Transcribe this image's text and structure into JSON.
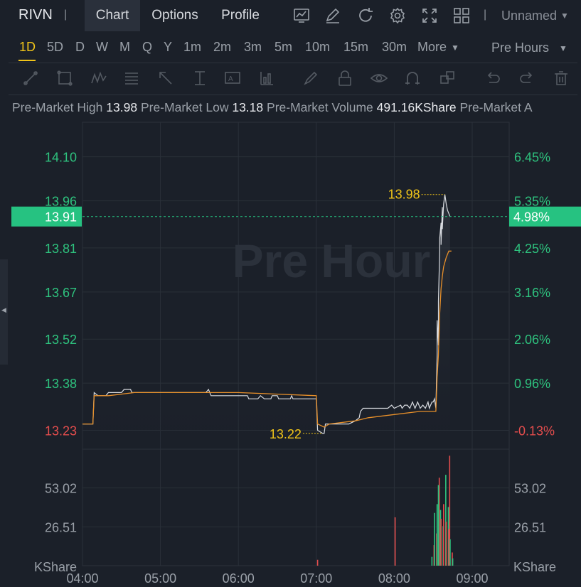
{
  "header": {
    "ticker": "RIVN",
    "separator": "|",
    "tabs": [
      {
        "label": "Chart",
        "active": true
      },
      {
        "label": "Options",
        "active": false
      },
      {
        "label": "Profile",
        "active": false
      }
    ],
    "icons": [
      "indicator-chart-icon",
      "draw-pen-icon",
      "refresh-icon",
      "settings-gear-icon",
      "fullscreen-icon",
      "layout-grid-icon"
    ],
    "layout_name": "Unnamed"
  },
  "timeframes": {
    "items": [
      "1D",
      "5D",
      "D",
      "W",
      "M",
      "Q",
      "Y",
      "1m",
      "2m",
      "3m",
      "5m",
      "10m",
      "15m",
      "30m",
      "More"
    ],
    "active": "1D",
    "session": "Pre Hours"
  },
  "drawing_tools": [
    "trend-line-icon",
    "rectangle-icon",
    "pattern-icon",
    "fib-lines-icon",
    "arrow-icon",
    "measure-icon",
    "text-icon",
    "bar-pattern-icon",
    "brush-icon",
    "lock-icon",
    "eye-icon",
    "magnet-icon",
    "layers-icon",
    "undo-icon",
    "redo-icon",
    "trash-icon"
  ],
  "stats": {
    "high_label": "Pre-Market High",
    "high_value": "13.98",
    "low_label": "Pre-Market Low",
    "low_value": "13.18",
    "volume_label": "Pre-Market Volume",
    "volume_value": "491.16KShare",
    "trailing_label": "Pre-Market A"
  },
  "chart_data": {
    "type": "line",
    "watermark": "Pre Hour",
    "x_ticks": [
      "04:00",
      "05:00",
      "06:00",
      "07:00",
      "08:00",
      "09:00"
    ],
    "price_ticks_left": [
      "14.10",
      "13.96",
      "13.81",
      "13.67",
      "13.52",
      "13.38",
      "13.23"
    ],
    "percent_ticks_right": [
      "6.45%",
      "5.35%",
      "4.25%",
      "3.16%",
      "2.06%",
      "0.96%",
      "-0.13%"
    ],
    "ylim": [
      13.17,
      14.21
    ],
    "prev_close": 13.25,
    "last_price": "13.91",
    "last_percent": "4.98%",
    "high_marker": {
      "label": "13.98",
      "time": "08:39",
      "value": 13.98
    },
    "low_marker": {
      "label": "13.22",
      "time": "07:05",
      "value": 13.22
    },
    "series": [
      {
        "name": "Price",
        "color": "#d8dbe0",
        "points": [
          [
            "04:00",
            13.25
          ],
          [
            "04:08",
            13.25
          ],
          [
            "04:09",
            13.35
          ],
          [
            "04:12",
            13.34
          ],
          [
            "04:18",
            13.34
          ],
          [
            "04:20",
            13.35
          ],
          [
            "04:30",
            13.35
          ],
          [
            "04:32",
            13.36
          ],
          [
            "04:37",
            13.36
          ],
          [
            "04:38",
            13.35
          ],
          [
            "05:35",
            13.35
          ],
          [
            "05:37",
            13.36
          ],
          [
            "05:39",
            13.34
          ],
          [
            "05:55",
            13.34
          ],
          [
            "06:07",
            13.34
          ],
          [
            "06:08",
            13.33
          ],
          [
            "06:15",
            13.33
          ],
          [
            "06:17",
            13.34
          ],
          [
            "06:20",
            13.33
          ],
          [
            "06:25",
            13.33
          ],
          [
            "06:26",
            13.34
          ],
          [
            "06:30",
            13.34
          ],
          [
            "06:31",
            13.33
          ],
          [
            "06:40",
            13.33
          ],
          [
            "06:41",
            13.34
          ],
          [
            "06:42",
            13.33
          ],
          [
            "07:00",
            13.33
          ],
          [
            "07:01",
            13.23
          ],
          [
            "07:05",
            13.22
          ],
          [
            "07:06",
            13.22
          ],
          [
            "07:07",
            13.25
          ],
          [
            "07:15",
            13.25
          ],
          [
            "07:25",
            13.25
          ],
          [
            "07:30",
            13.26
          ],
          [
            "07:33",
            13.27
          ],
          [
            "07:34",
            13.29
          ],
          [
            "07:36",
            13.3
          ],
          [
            "07:40",
            13.3
          ],
          [
            "07:45",
            13.3
          ],
          [
            "07:50",
            13.3
          ],
          [
            "07:55",
            13.3
          ],
          [
            "07:58",
            13.31
          ],
          [
            "08:00",
            13.3
          ],
          [
            "08:05",
            13.31
          ],
          [
            "08:06",
            13.3
          ],
          [
            "08:08",
            13.31
          ],
          [
            "08:10",
            13.31
          ],
          [
            "08:12",
            13.3
          ],
          [
            "08:14",
            13.32
          ],
          [
            "08:16",
            13.3
          ],
          [
            "08:18",
            13.32
          ],
          [
            "08:20",
            13.3
          ],
          [
            "08:22",
            13.31
          ],
          [
            "08:24",
            13.3
          ],
          [
            "08:26",
            13.32
          ],
          [
            "08:27",
            13.3
          ],
          [
            "08:28",
            13.31
          ],
          [
            "08:29",
            13.32
          ],
          [
            "08:30",
            13.32
          ],
          [
            "08:31",
            13.33
          ],
          [
            "08:32",
            13.3
          ],
          [
            "08:33",
            13.47
          ],
          [
            "08:33",
            13.58
          ],
          [
            "08:34",
            13.5
          ],
          [
            "08:34",
            13.64
          ],
          [
            "08:35",
            13.8
          ],
          [
            "08:35",
            13.84
          ],
          [
            "08:36",
            13.89
          ],
          [
            "08:36",
            13.82
          ],
          [
            "08:37",
            13.94
          ],
          [
            "08:37",
            13.87
          ],
          [
            "08:38",
            13.95
          ],
          [
            "08:39",
            13.98
          ],
          [
            "08:40",
            13.95
          ],
          [
            "08:41",
            13.93
          ],
          [
            "08:42",
            13.92
          ],
          [
            "08:43",
            13.91
          ]
        ]
      },
      {
        "name": "Average",
        "color": "#e8902a",
        "points": [
          [
            "04:00",
            13.25
          ],
          [
            "04:08",
            13.25
          ],
          [
            "04:09",
            13.34
          ],
          [
            "04:20",
            13.34
          ],
          [
            "04:40",
            13.35
          ],
          [
            "06:00",
            13.35
          ],
          [
            "07:00",
            13.34
          ],
          [
            "07:01",
            13.25
          ],
          [
            "07:06",
            13.24
          ],
          [
            "07:10",
            13.25
          ],
          [
            "07:30",
            13.26
          ],
          [
            "07:40",
            13.27
          ],
          [
            "08:00",
            13.28
          ],
          [
            "08:20",
            13.29
          ],
          [
            "08:30",
            13.29
          ],
          [
            "08:32",
            13.29
          ],
          [
            "08:33",
            13.4
          ],
          [
            "08:34",
            13.47
          ],
          [
            "08:35",
            13.6
          ],
          [
            "08:36",
            13.68
          ],
          [
            "08:37",
            13.72
          ],
          [
            "08:38",
            13.75
          ],
          [
            "08:40",
            13.78
          ],
          [
            "08:42",
            13.8
          ],
          [
            "08:44",
            13.8
          ]
        ]
      }
    ],
    "volume": {
      "unit": "KShare",
      "ticks_left": [
        "53.02",
        "26.51"
      ],
      "ticks_right": [
        "53.02",
        "26.51"
      ],
      "ylim": [
        0,
        79.5
      ],
      "bars": [
        {
          "time": "07:01",
          "value": 4.0,
          "dir": "down"
        },
        {
          "time": "08:00",
          "value": 33.0,
          "dir": "down"
        },
        {
          "time": "08:29",
          "value": 6.0,
          "dir": "up"
        },
        {
          "time": "08:30",
          "value": 14.0,
          "dir": "down"
        },
        {
          "time": "08:31",
          "value": 36.0,
          "dir": "up"
        },
        {
          "time": "08:32",
          "value": 22.0,
          "dir": "down"
        },
        {
          "time": "08:33",
          "value": 42.0,
          "dir": "up"
        },
        {
          "time": "08:34",
          "value": 60.0,
          "dir": "down"
        },
        {
          "time": "08:34",
          "value": 55.0,
          "dir": "up"
        },
        {
          "time": "08:35",
          "value": 38.0,
          "dir": "up"
        },
        {
          "time": "08:36",
          "value": 32.0,
          "dir": "down"
        },
        {
          "time": "08:37",
          "value": 27.0,
          "dir": "up"
        },
        {
          "time": "08:38",
          "value": 42.0,
          "dir": "down"
        },
        {
          "time": "08:39",
          "value": 62.0,
          "dir": "up"
        },
        {
          "time": "08:40",
          "value": 30.0,
          "dir": "down"
        },
        {
          "time": "08:41",
          "value": 40.0,
          "dir": "up"
        },
        {
          "time": "08:42",
          "value": 25.0,
          "dir": "down"
        },
        {
          "time": "08:42",
          "value": 75.0,
          "dir": "down"
        },
        {
          "time": "08:43",
          "value": 18.0,
          "dir": "up"
        },
        {
          "time": "08:44",
          "value": 9.0,
          "dir": "down"
        },
        {
          "time": "08:45",
          "value": 5.0,
          "dir": "up"
        }
      ]
    }
  },
  "colors": {
    "up": "#2ec27e",
    "down": "#e34d4d",
    "accent": "#f0c419",
    "last_price_tag": "#26c281",
    "average_line": "#e8902a"
  }
}
